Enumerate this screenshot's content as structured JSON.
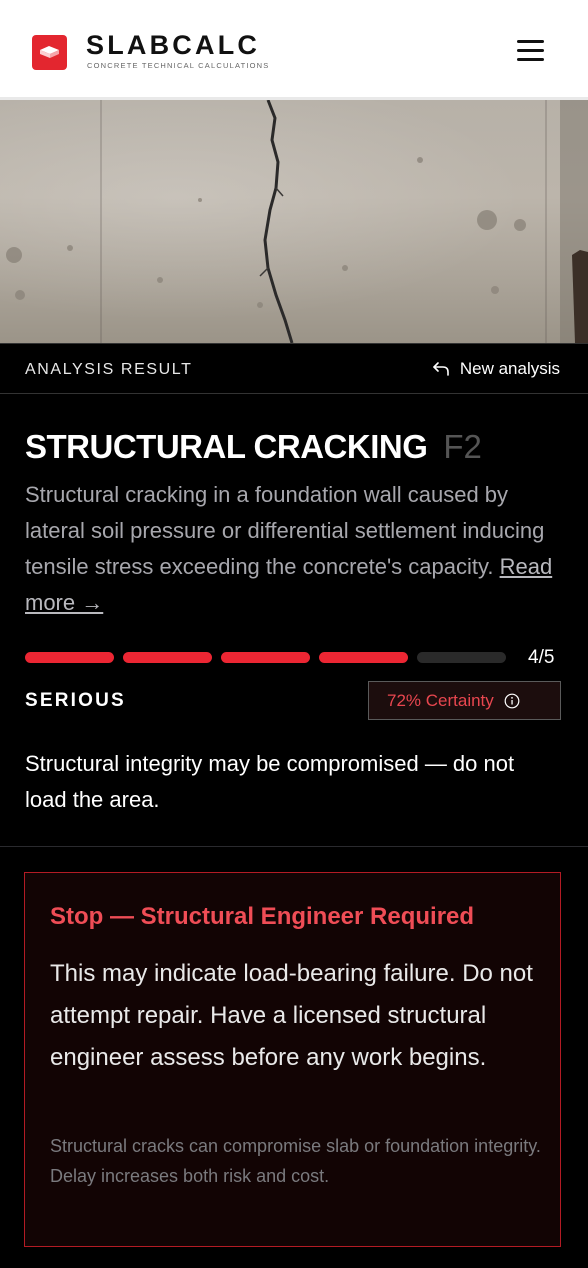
{
  "header": {
    "brand_name": "SLABCALC",
    "brand_tagline": "CONCRETE TECHNICAL CALCULATIONS",
    "logo_icon": "concrete-slab-icon",
    "menu_icon": "hamburger-menu-icon"
  },
  "result_bar": {
    "label": "ANALYSIS RESULT",
    "new_analysis_label": "New analysis",
    "new_analysis_icon": "undo-arrow-icon"
  },
  "result": {
    "title": "STRUCTURAL CRACKING",
    "code": "F2",
    "description": "Structural cracking in a foundation wall caused by lateral soil pressure or differential settlement inducing tensile stress exceeding the concrete's capacity. ",
    "read_more": "Read more →",
    "severity_level": 4,
    "severity_max": 5,
    "severity_count": "4/5",
    "severity_label": "SERIOUS",
    "certainty": "72% Certainty",
    "certainty_icon": "info-icon",
    "impact": "Structural integrity may be compromised — do not load the area."
  },
  "warning": {
    "title": "Stop — Structural Engineer Required",
    "body": "This may indicate load-bearing failure. Do not attempt repair. Have a licensed structural engineer assess before any work begins.",
    "note": "Structural cracks can compromise slab or foundation integrity. Delay increases both risk and cost."
  },
  "colors": {
    "accent": "#ec2633",
    "warning_title": "#ef4d56",
    "inactive_segment": "#2a2a2a"
  }
}
